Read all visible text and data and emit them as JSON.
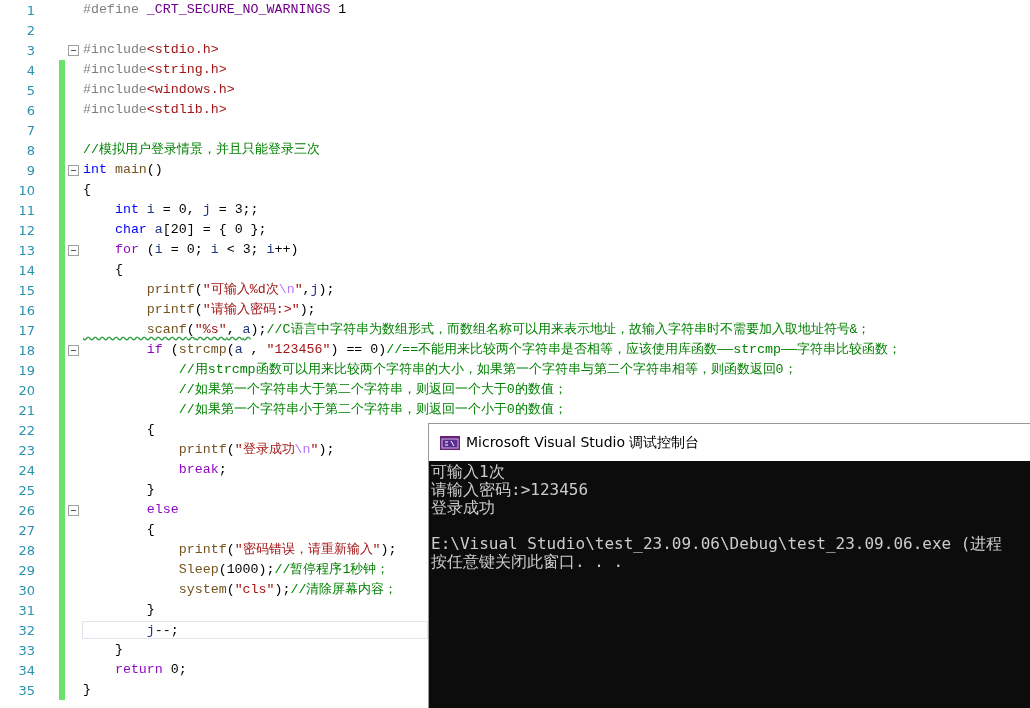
{
  "editor": {
    "lines": [
      {
        "number": "1",
        "fold": false,
        "changed": false,
        "current": false,
        "tokens": [
          {
            "text": "#define ",
            "kind": "pp"
          },
          {
            "text": "_CRT_SECURE_NO_WARNINGS",
            "kind": "macro"
          },
          {
            "text": " 1",
            "kind": "plain"
          }
        ]
      },
      {
        "number": "2",
        "fold": false,
        "changed": false,
        "current": false
      },
      {
        "number": "3",
        "fold": true,
        "changed": false,
        "current": false,
        "tokens": [
          {
            "text": "#include",
            "kind": "pp"
          },
          {
            "text": "<stdio.h>",
            "kind": "str"
          }
        ]
      },
      {
        "number": "4",
        "fold": false,
        "changed": true,
        "current": false,
        "tokens": [
          {
            "text": "#include",
            "kind": "pp"
          },
          {
            "text": "<string.h>",
            "kind": "str"
          }
        ]
      },
      {
        "number": "5",
        "fold": false,
        "changed": true,
        "current": false,
        "tokens": [
          {
            "text": "#include",
            "kind": "pp"
          },
          {
            "text": "<windows.h>",
            "kind": "str"
          }
        ]
      },
      {
        "number": "6",
        "fold": false,
        "changed": true,
        "current": false,
        "tokens": [
          {
            "text": "#include",
            "kind": "pp"
          },
          {
            "text": "<stdlib.h>",
            "kind": "str"
          }
        ]
      },
      {
        "number": "7",
        "fold": false,
        "changed": true,
        "current": false
      },
      {
        "number": "8",
        "fold": false,
        "changed": true,
        "current": false,
        "tokens": [
          {
            "text": "//模拟用户登录情景，并且只能登录三次",
            "kind": "cmt"
          }
        ]
      },
      {
        "number": "9",
        "fold": true,
        "changed": true,
        "current": false,
        "tokens": [
          {
            "text": "int",
            "kind": "kw"
          },
          {
            "text": " main",
            "kind": "fn"
          },
          {
            "text": "()",
            "kind": "plain"
          }
        ]
      },
      {
        "number": "10",
        "fold": false,
        "changed": true,
        "current": false,
        "tokens": [
          {
            "text": "{",
            "kind": "plain"
          }
        ]
      },
      {
        "number": "11",
        "fold": false,
        "changed": true,
        "current": false,
        "tokens": [
          {
            "text": "    int",
            "kind": "kw"
          },
          {
            "text": " i",
            "kind": "var"
          },
          {
            "text": " = 0, ",
            "kind": "plain"
          },
          {
            "text": "j",
            "kind": "var"
          },
          {
            "text": " = 3;;",
            "kind": "plain"
          }
        ]
      },
      {
        "number": "12",
        "fold": false,
        "changed": true,
        "current": false,
        "tokens": [
          {
            "text": "    char",
            "kind": "kw"
          },
          {
            "text": " a",
            "kind": "var"
          },
          {
            "text": "[20] = { 0 };",
            "kind": "plain"
          }
        ]
      },
      {
        "number": "13",
        "fold": true,
        "changed": true,
        "current": false,
        "tokens": [
          {
            "text": "    for",
            "kind": "ctl"
          },
          {
            "text": " (",
            "kind": "plain"
          },
          {
            "text": "i",
            "kind": "var"
          },
          {
            "text": " = 0; ",
            "kind": "plain"
          },
          {
            "text": "i",
            "kind": "var"
          },
          {
            "text": " < 3; ",
            "kind": "plain"
          },
          {
            "text": "i",
            "kind": "var"
          },
          {
            "text": "++)",
            "kind": "plain"
          }
        ]
      },
      {
        "number": "14",
        "fold": false,
        "changed": true,
        "current": false,
        "tokens": [
          {
            "text": "    {",
            "kind": "plain"
          }
        ]
      },
      {
        "number": "15",
        "fold": false,
        "changed": true,
        "current": false,
        "tokens": [
          {
            "text": "        printf",
            "kind": "fn"
          },
          {
            "text": "(",
            "kind": "plain"
          },
          {
            "text": "\"可输入%d次",
            "kind": "str"
          },
          {
            "text": "\\n",
            "kind": "esc"
          },
          {
            "text": "\"",
            "kind": "str"
          },
          {
            "text": ",",
            "kind": "plain"
          },
          {
            "text": "j",
            "kind": "var"
          },
          {
            "text": ");",
            "kind": "plain"
          }
        ]
      },
      {
        "number": "16",
        "fold": false,
        "changed": true,
        "current": false,
        "tokens": [
          {
            "text": "        printf",
            "kind": "fn"
          },
          {
            "text": "(",
            "kind": "plain"
          },
          {
            "text": "\"请输入密码:>\"",
            "kind": "str"
          },
          {
            "text": ");",
            "kind": "plain"
          }
        ]
      },
      {
        "number": "17",
        "fold": false,
        "changed": true,
        "current": false,
        "tokens": [
          {
            "text": "        scanf",
            "kind": "fn-warn"
          },
          {
            "text": "(",
            "kind": "plain-warn"
          },
          {
            "text": "\"%s\"",
            "kind": "str-warn"
          },
          {
            "text": ", ",
            "kind": "plain-warn"
          },
          {
            "text": "a",
            "kind": "var-warn"
          },
          {
            "text": ");",
            "kind": "plain"
          },
          {
            "text": "//C语言中字符串为数组形式，而数组名称可以用来表示地址，故输入字符串时不需要加入取地址符号&；",
            "kind": "cmt"
          }
        ]
      },
      {
        "number": "18",
        "fold": true,
        "changed": true,
        "current": false,
        "tokens": [
          {
            "text": "        if",
            "kind": "ctl"
          },
          {
            "text": " (",
            "kind": "plain"
          },
          {
            "text": "strcmp",
            "kind": "fn"
          },
          {
            "text": "(",
            "kind": "plain"
          },
          {
            "text": "a",
            "kind": "var"
          },
          {
            "text": " , ",
            "kind": "plain"
          },
          {
            "text": "\"123456\"",
            "kind": "str"
          },
          {
            "text": ") == 0)",
            "kind": "plain"
          },
          {
            "text": "//==不能用来比较两个字符串是否相等，应该使用库函数——strcmp——字符串比较函数；",
            "kind": "cmt"
          }
        ]
      },
      {
        "number": "19",
        "fold": false,
        "changed": true,
        "current": false,
        "tokens": [
          {
            "text": "            //用strcmp函数可以用来比较两个字符串的大小，如果第一个字符串与第二个字符串相等，则函数返回0；",
            "kind": "cmt"
          }
        ]
      },
      {
        "number": "20",
        "fold": false,
        "changed": true,
        "current": false,
        "tokens": [
          {
            "text": "            //如果第一个字符串大于第二个字符串，则返回一个大于0的数值；",
            "kind": "cmt"
          }
        ]
      },
      {
        "number": "21",
        "fold": false,
        "changed": true,
        "current": false,
        "tokens": [
          {
            "text": "            //如果第一个字符串小于第二个字符串，则返回一个小于0的数值；",
            "kind": "cmt"
          }
        ]
      },
      {
        "number": "22",
        "fold": false,
        "changed": true,
        "current": false,
        "tokens": [
          {
            "text": "        {",
            "kind": "plain"
          }
        ]
      },
      {
        "number": "23",
        "fold": false,
        "changed": true,
        "current": false,
        "tokens": [
          {
            "text": "            printf",
            "kind": "fn"
          },
          {
            "text": "(",
            "kind": "plain"
          },
          {
            "text": "\"登录成功",
            "kind": "str"
          },
          {
            "text": "\\n",
            "kind": "esc"
          },
          {
            "text": "\"",
            "kind": "str"
          },
          {
            "text": ");",
            "kind": "plain"
          }
        ]
      },
      {
        "number": "24",
        "fold": false,
        "changed": true,
        "current": false,
        "tokens": [
          {
            "text": "            break",
            "kind": "ctl"
          },
          {
            "text": ";",
            "kind": "plain"
          }
        ]
      },
      {
        "number": "25",
        "fold": false,
        "changed": true,
        "current": false,
        "tokens": [
          {
            "text": "        }",
            "kind": "plain"
          }
        ]
      },
      {
        "number": "26",
        "fold": true,
        "changed": true,
        "current": false,
        "tokens": [
          {
            "text": "        else",
            "kind": "ctl"
          }
        ]
      },
      {
        "number": "27",
        "fold": false,
        "changed": true,
        "current": false,
        "tokens": [
          {
            "text": "        {",
            "kind": "plain"
          }
        ]
      },
      {
        "number": "28",
        "fold": false,
        "changed": true,
        "current": false,
        "tokens": [
          {
            "text": "            printf",
            "kind": "fn"
          },
          {
            "text": "(",
            "kind": "plain"
          },
          {
            "text": "\"密码错误，请重新输入\"",
            "kind": "str"
          },
          {
            "text": ");",
            "kind": "plain"
          }
        ]
      },
      {
        "number": "29",
        "fold": false,
        "changed": true,
        "current": false,
        "tokens": [
          {
            "text": "            Sleep",
            "kind": "fn"
          },
          {
            "text": "(1000);",
            "kind": "plain"
          },
          {
            "text": "//暂停程序1秒钟；",
            "kind": "cmt"
          }
        ]
      },
      {
        "number": "30",
        "fold": false,
        "changed": true,
        "current": false,
        "tokens": [
          {
            "text": "            system",
            "kind": "fn"
          },
          {
            "text": "(",
            "kind": "plain"
          },
          {
            "text": "\"cls\"",
            "kind": "str"
          },
          {
            "text": ");",
            "kind": "plain"
          },
          {
            "text": "//清除屏幕内容；",
            "kind": "cmt"
          }
        ]
      },
      {
        "number": "31",
        "fold": false,
        "changed": true,
        "current": false,
        "tokens": [
          {
            "text": "        }",
            "kind": "plain"
          }
        ]
      },
      {
        "number": "32",
        "fold": false,
        "changed": true,
        "current": true,
        "tokens": [
          {
            "text": "        j",
            "kind": "var"
          },
          {
            "text": "--;",
            "kind": "plain"
          }
        ]
      },
      {
        "number": "33",
        "fold": false,
        "changed": true,
        "current": false,
        "tokens": [
          {
            "text": "    }",
            "kind": "plain"
          }
        ]
      },
      {
        "number": "34",
        "fold": false,
        "changed": true,
        "current": false,
        "tokens": [
          {
            "text": "    return",
            "kind": "ctl"
          },
          {
            "text": " 0;",
            "kind": "plain"
          }
        ]
      },
      {
        "number": "35",
        "fold": false,
        "changed": true,
        "current": false,
        "tokens": [
          {
            "text": "}",
            "kind": "plain"
          }
        ]
      }
    ]
  },
  "console": {
    "title": "Microsoft Visual Studio 调试控制台",
    "paragraphs": [
      [
        "可输入1次",
        "请输入密码:>123456",
        "登录成功"
      ],
      [
        "E:\\Visual Studio\\test_23.09.06\\Debug\\test_23.09.06.exe (进程",
        "按任意键关闭此窗口. . ."
      ]
    ]
  }
}
